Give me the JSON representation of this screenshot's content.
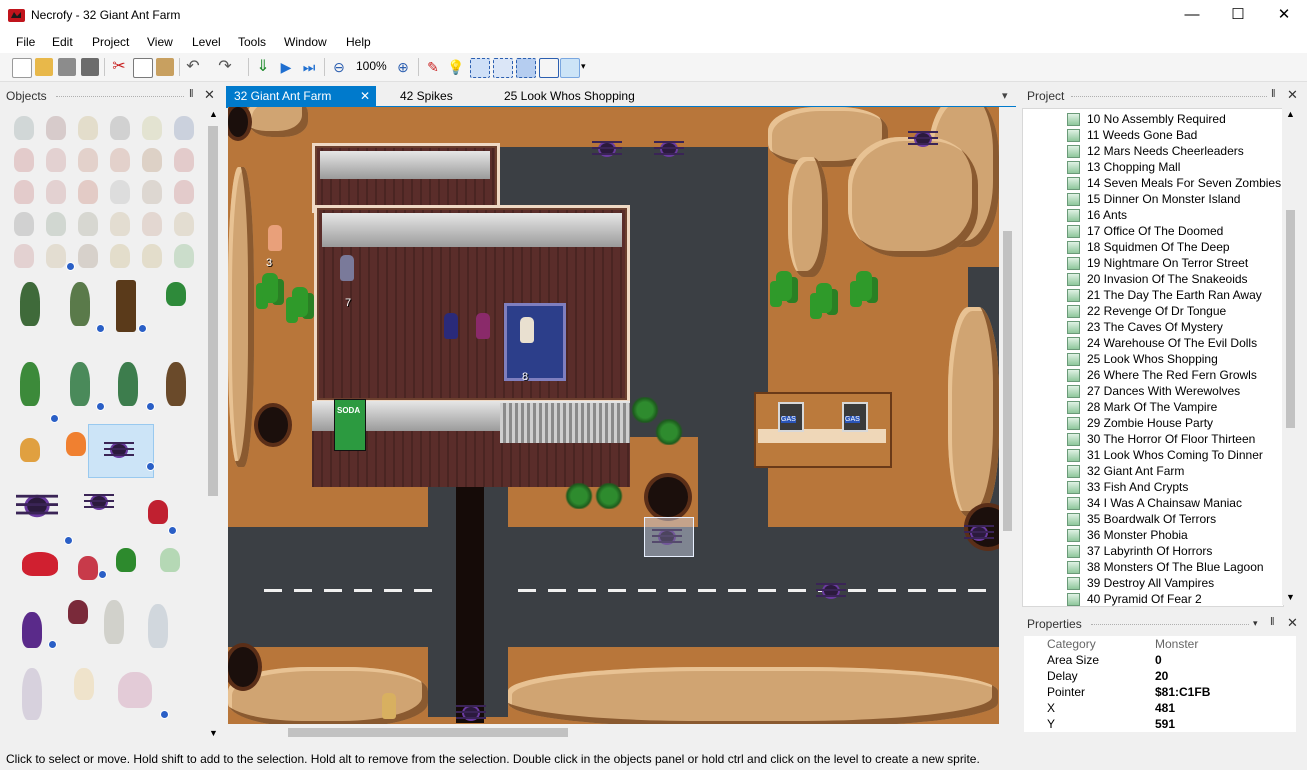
{
  "window": {
    "app_name": "Necrofy - 32 Giant Ant Farm",
    "minimize": "—",
    "maximize": "☐",
    "close": "✕"
  },
  "menu": [
    "File",
    "Edit",
    "Project",
    "View",
    "Level",
    "Tools",
    "Window",
    "Help"
  ],
  "toolbar": {
    "zoom": "100%",
    "icons": [
      "new-file-icon",
      "open-folder-icon",
      "save-icon",
      "save-all-icon",
      "cut-icon",
      "copy-icon",
      "paste-icon",
      "undo-icon",
      "redo-icon",
      "build-run-icon",
      "run-icon",
      "run-from-here-icon",
      "zoom-out-icon",
      "zoom-in-icon",
      "pencil-icon",
      "lightbulb-icon",
      "select-rect-icon",
      "select-all-icon",
      "select-tiles-icon",
      "resize-icon",
      "sprite-mode-icon"
    ]
  },
  "objects_panel": {
    "title": "Objects",
    "pin": "‖",
    "close": "✕"
  },
  "tabs": [
    {
      "label": "32 Giant Ant Farm",
      "active": true,
      "close": "✕"
    },
    {
      "label": "42 Spikes",
      "active": false
    },
    {
      "label": "25 Look Whos Shopping",
      "active": false
    }
  ],
  "tab_overflow": "▾",
  "level": {
    "labels": [
      "3",
      "7",
      "8"
    ],
    "soda": "SODA",
    "gas": "GAS"
  },
  "project_panel": {
    "title": "Project",
    "pin": "‖",
    "close": "✕",
    "items": [
      "10 No Assembly Required",
      "11 Weeds Gone Bad",
      "12 Mars Needs Cheerleaders",
      "13 Chopping Mall",
      "14 Seven Meals For Seven Zombies",
      "15 Dinner On Monster Island",
      "16 Ants",
      "17 Office Of The Doomed",
      "18 Squidmen Of The Deep",
      "19 Nightmare On Terror Street",
      "20 Invasion Of The Snakeoids",
      "21 The Day The Earth Ran Away",
      "22 Revenge Of Dr Tongue",
      "23 The Caves Of Mystery",
      "24 Warehouse Of The Evil Dolls",
      "25 Look Whos Shopping",
      "26 Where The Red Fern Growls",
      "27 Dances With Werewolves",
      "28 Mark Of The Vampire",
      "29 Zombie House Party",
      "30 The Horror Of Floor Thirteen",
      "31 Look Whos Coming To Dinner",
      "32 Giant Ant Farm",
      "33 Fish And Crypts",
      "34 I  Was  A Chainsaw Maniac",
      "35 Boardwalk Of Terrors",
      "36 Monster Phobia",
      "37 Labyrinth Of Horrors",
      "38 Monsters Of The Blue Lagoon",
      "39 Destroy All Vampires",
      "40 Pyramid Of Fear 2"
    ]
  },
  "properties_panel": {
    "title": "Properties",
    "dropdown": "▾",
    "pin": "‖",
    "close": "✕",
    "rows": [
      {
        "key": "Category",
        "value": "Monster"
      },
      {
        "key": "Area Size",
        "value": "0"
      },
      {
        "key": "Delay",
        "value": "20"
      },
      {
        "key": "Pointer",
        "value": "$81:C1FB"
      },
      {
        "key": "X",
        "value": "481"
      },
      {
        "key": "Y",
        "value": "591"
      }
    ]
  },
  "status": "Click to select or move. Hold shift to add to the selection. Hold alt to remove from the selection. Double click in the objects panel or hold ctrl and click on the level to create a new sprite.",
  "colors": {
    "accent": "#007acc",
    "road": "#3b3f44",
    "dirt": "#bb7a3c"
  }
}
